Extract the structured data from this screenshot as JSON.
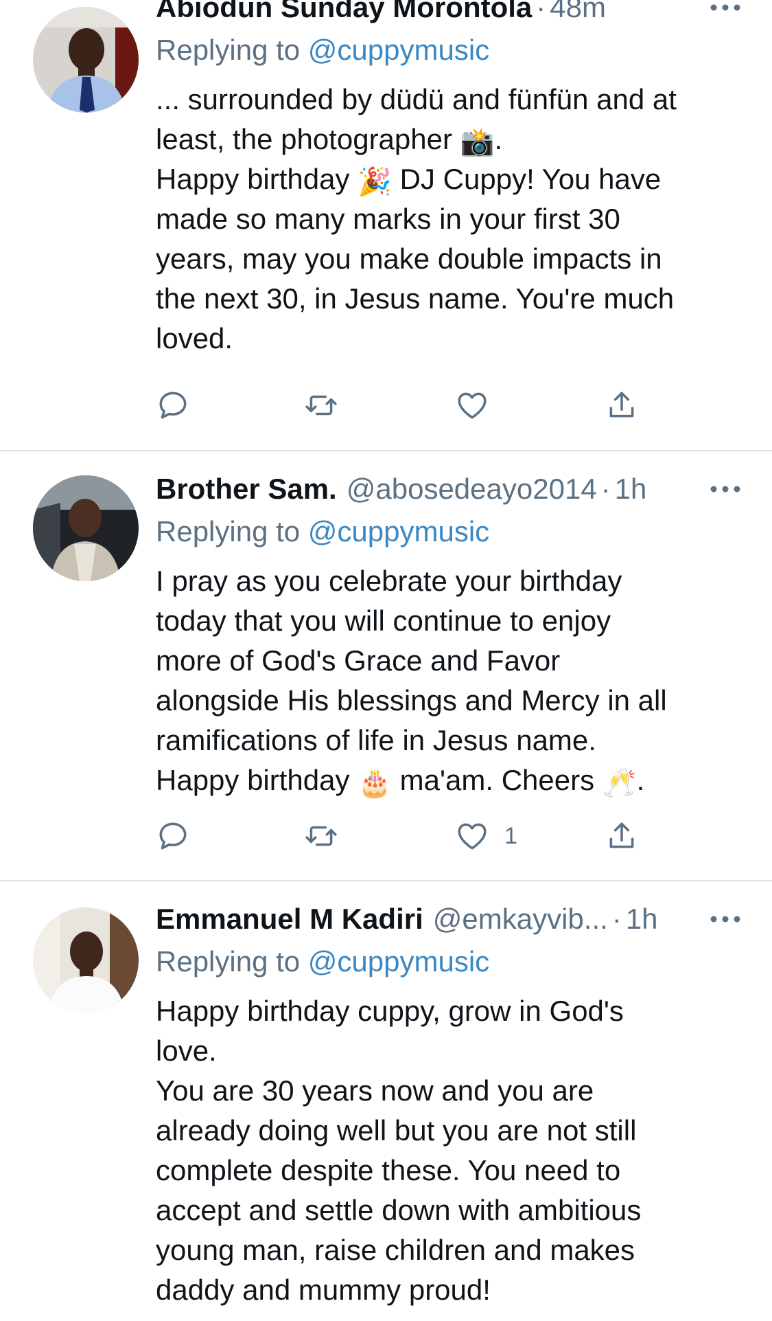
{
  "tweets": [
    {
      "name": "Abiodun Sunday Morontola",
      "handle": "",
      "time": "48m",
      "replying_prefix": "Replying to",
      "replying_to": "@cuppymusic",
      "lines": [
        "... surrounded by düdü and fünfün and at",
        "least, the photographer",
        "Happy birthday",
        "DJ Cuppy! You have",
        "made so many marks in your first 30",
        "years, may you make double impacts in",
        "the next 30, in Jesus name. You're much",
        "loved."
      ],
      "emojis": [
        "📸",
        "🎉"
      ],
      "like_count": ""
    },
    {
      "name": "Brother Sam.",
      "handle": "@abosedeayo2014",
      "time": "1h",
      "replying_prefix": "Replying to",
      "replying_to": "@cuppymusic",
      "lines": [
        "I pray as you celebrate your birthday",
        "today that you will continue to enjoy",
        "more of God's Grace and Favor",
        "alongside His blessings and Mercy in all",
        "ramifications of life in Jesus name.",
        "Happy birthday",
        "ma'am. Cheers",
        "."
      ],
      "emojis": [
        "🎂",
        "🥂"
      ],
      "like_count": "1"
    },
    {
      "name": "Emmanuel M Kadiri",
      "handle": "@emkayvib...",
      "time": "1h",
      "replying_prefix": "Replying to",
      "replying_to": "@cuppymusic",
      "lines": [
        "Happy birthday cuppy, grow in God's",
        "love.",
        "You are 30 years now and you are",
        "already doing well but you are not still",
        "complete despite these. You need to",
        "accept and settle down with ambitious",
        "young man, raise children and makes",
        "daddy and mummy proud!"
      ],
      "emojis": [],
      "like_count": ""
    }
  ],
  "dot_separator": "·",
  "colors": {
    "text": "#0f1419",
    "secondary": "#5b7083",
    "link": "#3b88c3",
    "divider": "#dfe3e6"
  }
}
